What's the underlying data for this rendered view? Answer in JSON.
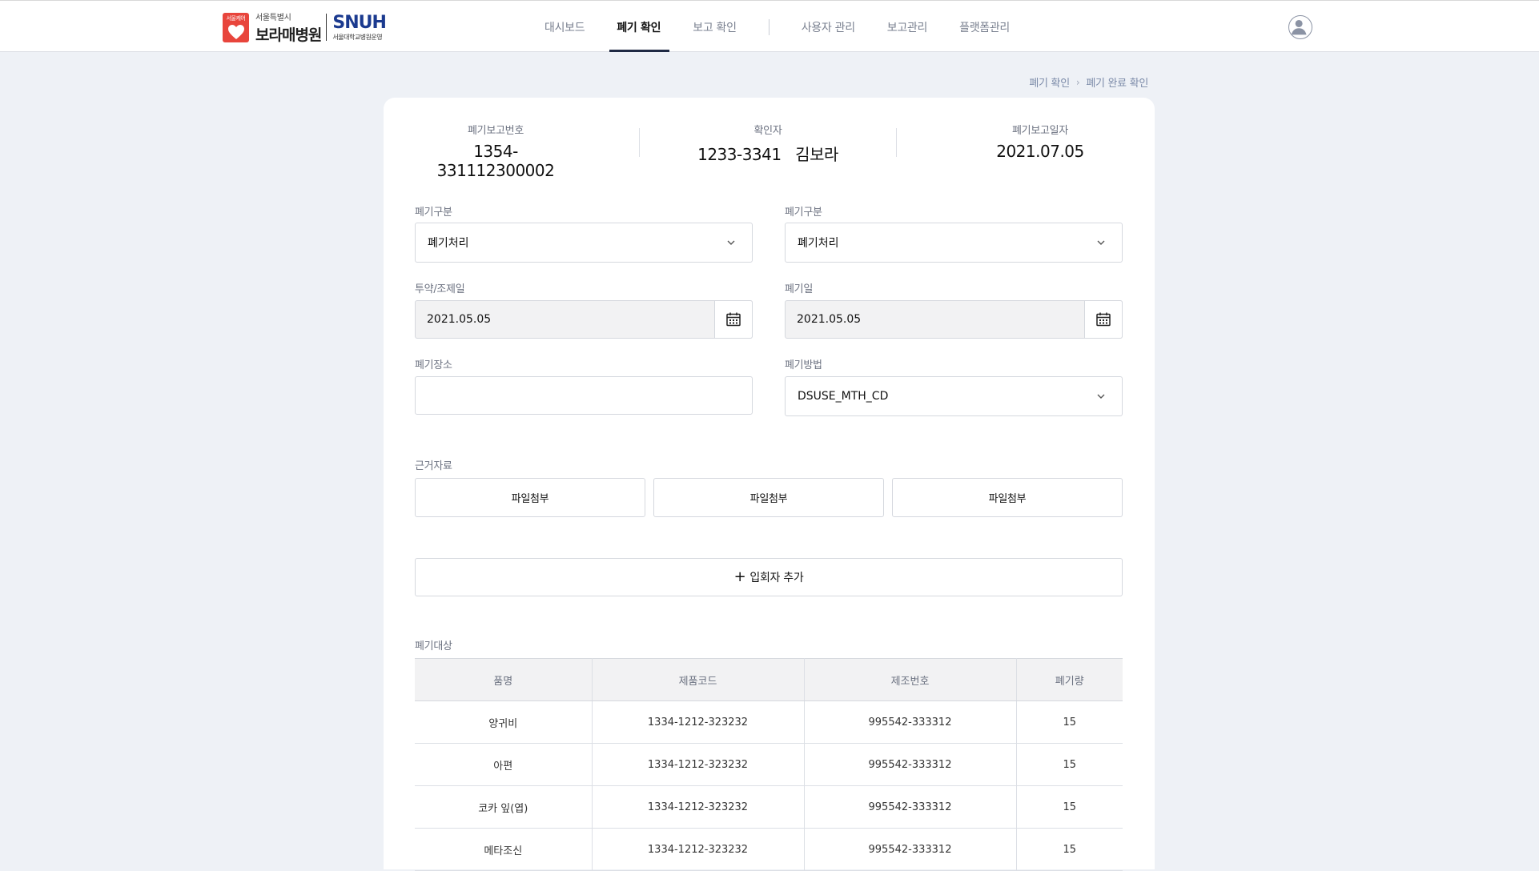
{
  "header": {
    "logo": {
      "badge_text": "서울케어",
      "sub": "서울특별시",
      "main": "보라매병원",
      "snuh": "SNUH",
      "snuh_sub": "서울대학교병원운영"
    },
    "nav": [
      {
        "label": "대시보드",
        "active": false
      },
      {
        "label": "폐기 확인",
        "active": true
      },
      {
        "label": "보고 확인",
        "active": false
      },
      {
        "label": "사용자 관리",
        "active": false
      },
      {
        "label": "보고관리",
        "active": false
      },
      {
        "label": "플랫폼관리",
        "active": false
      }
    ],
    "avatar_icon": "user-avatar-icon"
  },
  "breadcrumb": {
    "items": [
      "폐기 확인",
      "폐기 완료 확인"
    ]
  },
  "summary": {
    "report_no": {
      "label": "폐기보고번호",
      "value": "1354-331112300002"
    },
    "confirmer": {
      "label": "확인자",
      "value": "1233-3341   김보라"
    },
    "report_date": {
      "label": "폐기보고일자",
      "value": "2021.07.05"
    }
  },
  "form": {
    "disposal_type_1": {
      "label": "폐기구분",
      "value": "폐기처리"
    },
    "disposal_type_2": {
      "label": "폐기구분",
      "value": "폐기처리"
    },
    "dose_date": {
      "label": "투약/조제일",
      "value": "2021.05.05"
    },
    "disposal_date": {
      "label": "폐기일",
      "value": "2021.05.05"
    },
    "disposal_place": {
      "label": "폐기장소",
      "value": ""
    },
    "disposal_method": {
      "label": "폐기방법",
      "value": "DSUSE_MTH_CD"
    }
  },
  "evidence": {
    "label": "근거자료",
    "buttons": [
      "파일첨부",
      "파일첨부",
      "파일첨부"
    ]
  },
  "add_witness_label": "입회자 추가",
  "targets": {
    "label": "폐기대상",
    "columns": [
      "품명",
      "제품코드",
      "제조번호",
      "폐기량"
    ],
    "rows": [
      [
        "양귀비",
        "1334-1212-323232",
        "995542-333312",
        "15"
      ],
      [
        "아편",
        "1334-1212-323232",
        "995542-333312",
        "15"
      ],
      [
        "코카 잎(엽)",
        "1334-1212-323232",
        "995542-333312",
        "15"
      ],
      [
        "메타조신",
        "1334-1212-323232",
        "995542-333312",
        "15"
      ]
    ]
  },
  "colors": {
    "background": "#eef1f6",
    "accent": "#1f2a44",
    "logo_red": "#e8453c",
    "snuh_blue": "#1b3a8f"
  }
}
